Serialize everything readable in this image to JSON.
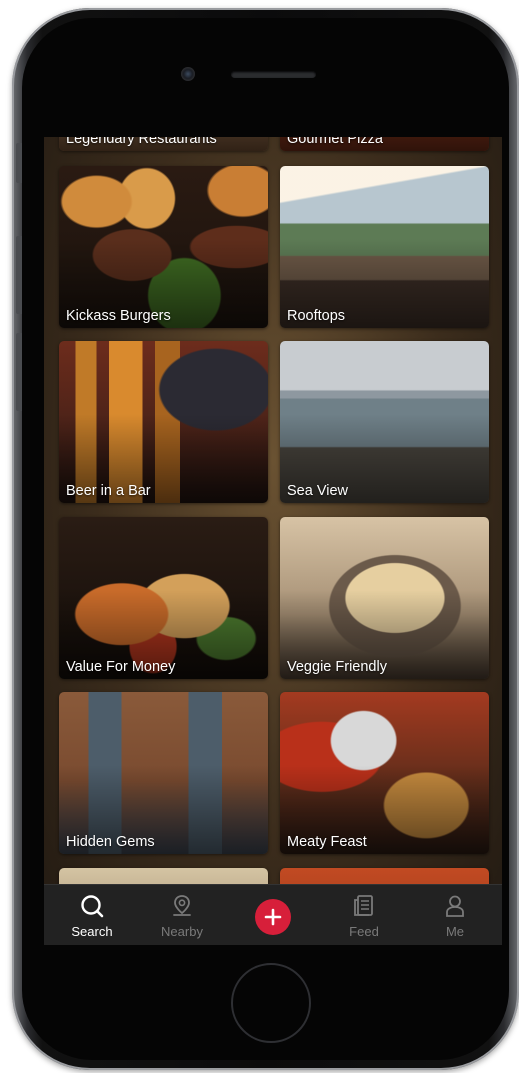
{
  "categories": [
    {
      "label": "Legendary Restaurants"
    },
    {
      "label": "Gourmet Pizza"
    },
    {
      "label": "Kickass Burgers"
    },
    {
      "label": "Rooftops"
    },
    {
      "label": "Beer in a Bar"
    },
    {
      "label": "Sea View"
    },
    {
      "label": "Value For Money"
    },
    {
      "label": "Veggie Friendly"
    },
    {
      "label": "Hidden Gems"
    },
    {
      "label": "Meaty Feast"
    }
  ],
  "tabbar": {
    "search": {
      "label": "Search",
      "icon": "search-icon"
    },
    "nearby": {
      "label": "Nearby",
      "icon": "location-pin-icon"
    },
    "add": {
      "icon": "plus-icon",
      "color": "#d71f3a"
    },
    "feed": {
      "label": "Feed",
      "icon": "feed-icon"
    },
    "me": {
      "label": "Me",
      "icon": "user-icon"
    }
  },
  "colors": {
    "accent": "#d71f3a",
    "tabbar_bg": "#222222",
    "tab_active": "#ffffff",
    "tab_inactive": "#7a7a7a"
  }
}
